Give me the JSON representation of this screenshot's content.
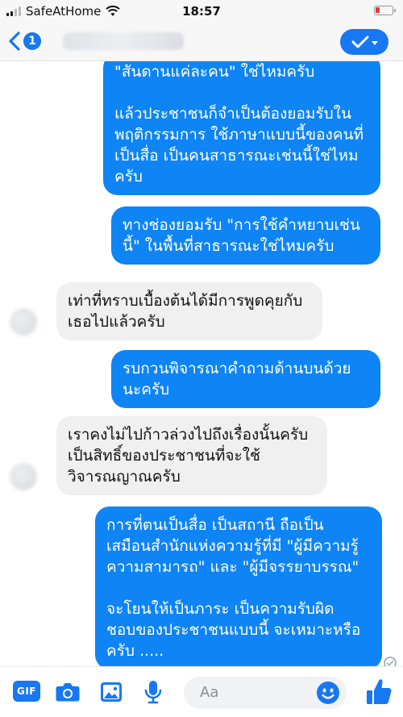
{
  "status_bar": {
    "carrier": "SafeAtHome",
    "time": "18:57"
  },
  "header": {
    "back_count": "1"
  },
  "messages": [
    {
      "sender": "me",
      "text": "\"สันดานแค่ละคน\" ใช่ไหมครับ\n\nแล้วประชาชนก็จำเป็นต้องยอมรับใน\nพฤติกรรมการ ใช้ภาษาแบบนี้ของคนที่\nเป็นสื่อ เป็นคนสาธารณะเช่นนี้ใช่ไหม\nครับ"
    },
    {
      "sender": "me",
      "text": "ทางช่องยอมรับ \"การใช้คำหยาบเช่น\nนี้\" ในพื้นที่สาธารณะใช่ไหมครับ"
    },
    {
      "sender": "them",
      "text": "เท่าที่ทราบเบื้องต้นได้มีการพูดคุยกับ\nเธอไปแล้วครับ"
    },
    {
      "sender": "me",
      "text": "รบกวนพิจารณาคำถามด้านบนด้วย\nนะครับ"
    },
    {
      "sender": "them",
      "text": "เราคงไม่ไปก้าวล่วงไปถึงเรื่องนั้นครับ\nเป็นสิทธิ์ของประชาชนที่จะใช้\nวิจารณญาณครับ"
    },
    {
      "sender": "me",
      "text": "การที่ตนเป็นสื่อ เป็นสถานี ถือเป็น\nเสมือนสำนักแห่งความรู้ที่มี \"ผู้มีความรู้\nความสามารถ\" และ \"ผู้มีจรรยาบรรณ\"\n\nจะโยนให้เป็นภาระ เป็นความรับผิด\nชอบของประชาชนแบบนี้ จะเหมาะหรือ\nครับ ....."
    }
  ],
  "composer": {
    "gif_label": "GIF",
    "placeholder": "Aa"
  },
  "colors": {
    "accent": "#1877f2",
    "outgoing_bubble": "#0e84f5",
    "incoming_bubble": "#f0f0f0"
  },
  "icons": [
    "signal-icon",
    "wifi-icon",
    "battery-icon",
    "back-chevron-icon",
    "check-icon",
    "gif-icon",
    "camera-icon",
    "photo-icon",
    "microphone-icon",
    "emoji-icon",
    "like-icon",
    "seen-check-icon"
  ]
}
